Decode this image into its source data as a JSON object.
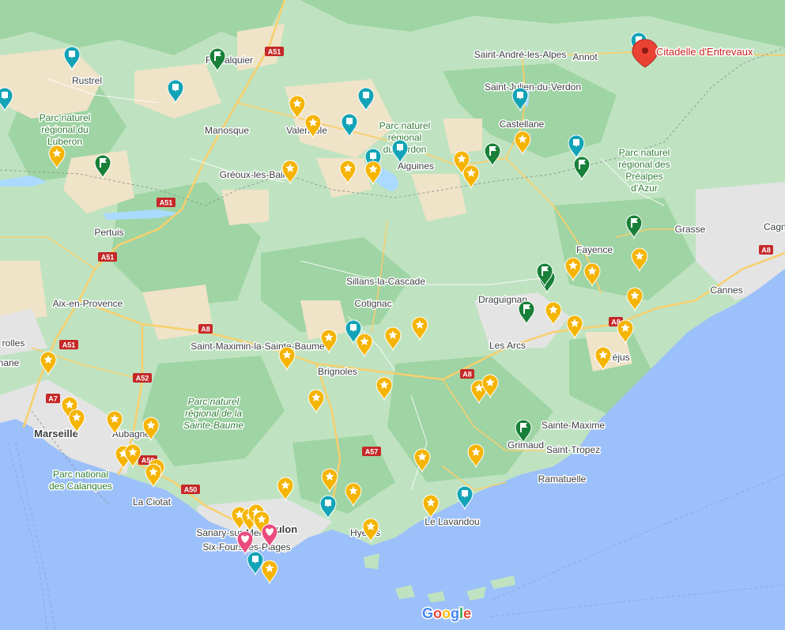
{
  "map": {
    "destination": {
      "label": "Citadelle d'Entrevaux",
      "pin_color": "#ea4335"
    },
    "cities": [
      {
        "id": "rustrel",
        "name": "Rustrel"
      },
      {
        "id": "forcalquier",
        "name": "Forcalquier"
      },
      {
        "id": "saint-andre",
        "name": "Saint-André-les-Alpes"
      },
      {
        "id": "annot",
        "name": "Annot"
      },
      {
        "id": "saint-julien",
        "name": "Saint-Julien-du-Verdon"
      },
      {
        "id": "manosque",
        "name": "Manosque"
      },
      {
        "id": "valensole",
        "name": "Valensole"
      },
      {
        "id": "castellane",
        "name": "Castellane"
      },
      {
        "id": "aiguines",
        "name": "Aiguines"
      },
      {
        "id": "greoux",
        "name": "Gréoux-les-Bains"
      },
      {
        "id": "pertuis",
        "name": "Pertuis"
      },
      {
        "id": "grasse",
        "name": "Grasse"
      },
      {
        "id": "cagnes",
        "name": "Cagnes-s"
      },
      {
        "id": "fayence",
        "name": "Fayence"
      },
      {
        "id": "cannes",
        "name": "Cannes"
      },
      {
        "id": "sillans",
        "name": "Sillans-la-Cascade"
      },
      {
        "id": "draguignan",
        "name": "Draguignan"
      },
      {
        "id": "aix",
        "name": "Aix-en-Provence"
      },
      {
        "id": "cotignac",
        "name": "Cotignac"
      },
      {
        "id": "rolles",
        "name": "rolles"
      },
      {
        "id": "saint-maximin",
        "name": "Saint-Maximin-la-Sainte-Baume"
      },
      {
        "id": "les-arcs",
        "name": "Les Arcs"
      },
      {
        "id": "frejus",
        "name": "Fréjus"
      },
      {
        "id": "mane",
        "name": "nane"
      },
      {
        "id": "brignoles",
        "name": "Brignoles"
      },
      {
        "id": "marseille",
        "name": "Marseille"
      },
      {
        "id": "aubagne",
        "name": "Aubagne"
      },
      {
        "id": "sainte-maxime",
        "name": "Sainte-Maxime"
      },
      {
        "id": "grimaud",
        "name": "Grimaud"
      },
      {
        "id": "saint-tropez",
        "name": "Saint-Tropez"
      },
      {
        "id": "ramatuelle",
        "name": "Ramatuelle"
      },
      {
        "id": "la-ciotat",
        "name": "La Ciotat"
      },
      {
        "id": "toulon",
        "name": "Toulon"
      },
      {
        "id": "le-lavandou",
        "name": "Le Lavandou"
      },
      {
        "id": "sanary",
        "name": "Sanary-sur-Mer"
      },
      {
        "id": "hyeres",
        "name": "Hyères"
      },
      {
        "id": "six-fours",
        "name": "Six-Fours-les-Plages"
      }
    ],
    "parks": [
      {
        "id": "luberon",
        "lines": [
          "Parc naturel",
          "régional du",
          "Luberon"
        ]
      },
      {
        "id": "verdon",
        "lines": [
          "Parc naturel",
          "régional",
          "du Verdon"
        ]
      },
      {
        "id": "prealpes",
        "lines": [
          "Parc naturel",
          "régional des",
          "Préalpes",
          "d'Azur"
        ]
      },
      {
        "id": "sainte-baume",
        "lines": [
          "Parc naturel",
          "régional de la",
          "Sainte-Baume"
        ]
      },
      {
        "id": "calanques",
        "lines": [
          "Parc national",
          "des Calanques"
        ]
      }
    ],
    "roads": [
      {
        "id": "a51-n",
        "label": "A51"
      },
      {
        "id": "a51-pertuis",
        "label": "A51"
      },
      {
        "id": "a51-s",
        "label": "A51"
      },
      {
        "id": "a51-aix",
        "label": "A51"
      },
      {
        "id": "a8-w",
        "label": "A8"
      },
      {
        "id": "a8-c",
        "label": "A8"
      },
      {
        "id": "a8-e",
        "label": "A8"
      },
      {
        "id": "a8-far",
        "label": "A8"
      },
      {
        "id": "a52",
        "label": "A52"
      },
      {
        "id": "a7",
        "label": "A7"
      },
      {
        "id": "a50-a",
        "label": "A50"
      },
      {
        "id": "a50-b",
        "label": "A50"
      },
      {
        "id": "a57",
        "label": "A57"
      }
    ],
    "marker_colors": {
      "star": "#f5b400",
      "teal": "#12a4b6",
      "flag": "#188038",
      "heart": "#ea4c7d"
    },
    "attribution": "Google"
  }
}
